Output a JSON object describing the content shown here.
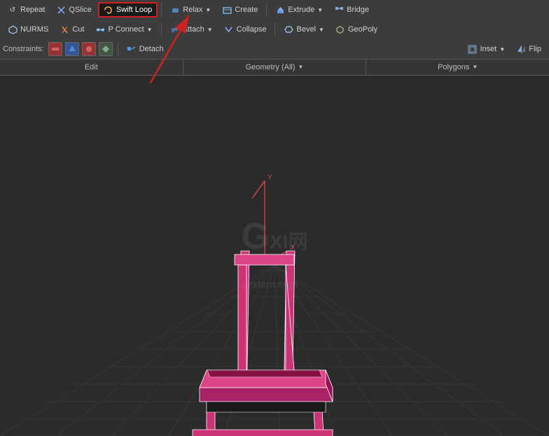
{
  "toolbar": {
    "row1": {
      "buttons": [
        {
          "id": "repeat",
          "label": "Repeat",
          "icon": "↺"
        },
        {
          "id": "qslice",
          "label": "QSlice",
          "icon": "✂"
        },
        {
          "id": "swiftloop",
          "label": "Swift Loop",
          "icon": "⟲",
          "highlighted": true
        },
        {
          "id": "relax",
          "label": "Relax",
          "icon": "~",
          "hasArrow": true
        },
        {
          "id": "create",
          "label": "Create",
          "icon": "+"
        },
        {
          "id": "extrude",
          "label": "Extrude",
          "icon": "⬆",
          "hasArrow": true
        },
        {
          "id": "bridge",
          "label": "Bridge",
          "icon": "⇌"
        }
      ]
    },
    "row2": {
      "buttons": [
        {
          "id": "nurms",
          "label": "NURMS",
          "icon": "⬡"
        },
        {
          "id": "cut",
          "label": "Cut",
          "icon": "✂"
        },
        {
          "id": "pconnect",
          "label": "P Connect",
          "icon": "⊕",
          "hasArrow": true
        },
        {
          "id": "attach",
          "label": "Attach",
          "icon": "🔗",
          "hasArrow": true
        },
        {
          "id": "collapse",
          "label": "Collapse",
          "icon": "⬇"
        },
        {
          "id": "bevel",
          "label": "Bevel",
          "icon": "◈",
          "hasArrow": true
        },
        {
          "id": "geopoly",
          "label": "GeoPoly",
          "icon": "⬡"
        }
      ]
    },
    "row3": {
      "constraints_label": "Constraints:",
      "buttons": [
        {
          "id": "constraint1",
          "icon": "■",
          "color": "#cc4444"
        },
        {
          "id": "constraint2",
          "icon": "⬛",
          "color": "#4488cc"
        },
        {
          "id": "constraint3",
          "icon": "●",
          "color": "#cc4444"
        },
        {
          "id": "constraint4",
          "icon": "⬟",
          "color": "#888888"
        }
      ],
      "right_buttons": [
        {
          "id": "detach",
          "label": "Detach",
          "icon": "↗"
        },
        {
          "id": "inset",
          "label": "Inset",
          "icon": "▣",
          "hasArrow": true
        },
        {
          "id": "flip",
          "label": "Flip",
          "icon": "↔"
        }
      ]
    },
    "sections": [
      {
        "id": "edit",
        "label": "Edit"
      },
      {
        "id": "geometry",
        "label": "Geometry (All)",
        "hasArrow": true
      },
      {
        "id": "polygons",
        "label": "Polygons",
        "hasArrow": true
      }
    ]
  },
  "viewport": {
    "watermark": "GX网\nsystem.com"
  },
  "arrow": {
    "color": "#cc2222"
  }
}
